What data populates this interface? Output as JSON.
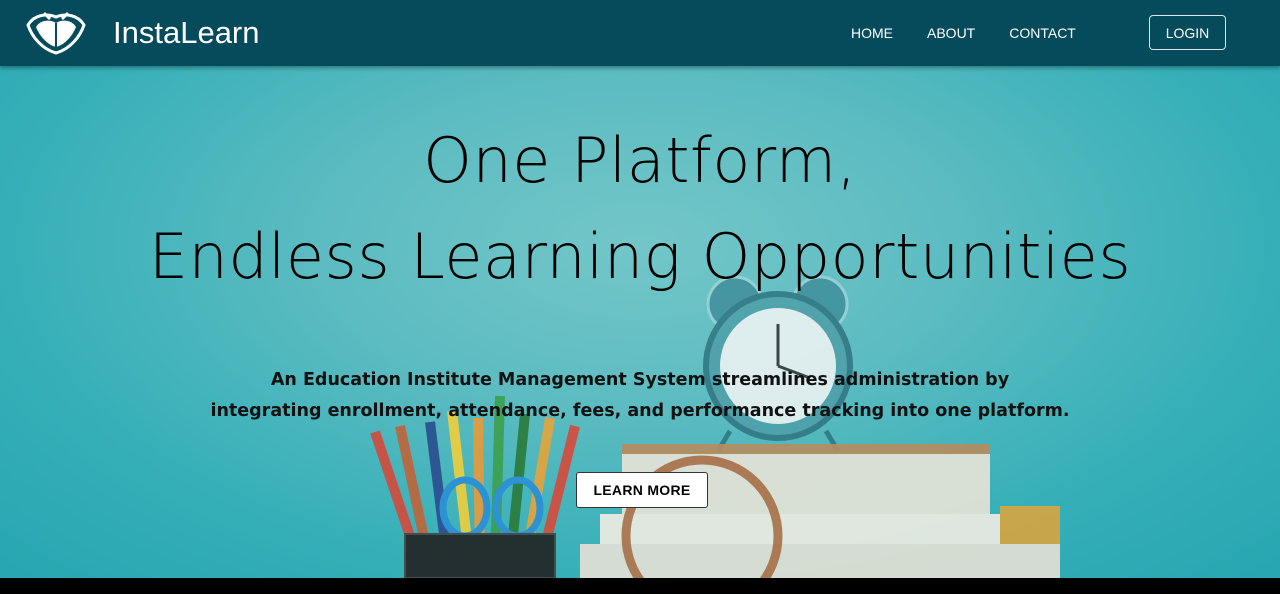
{
  "brand": {
    "name": "InstaLearn",
    "logo_icon": "open-book-shield-icon"
  },
  "nav": {
    "links": [
      "HOME",
      "ABOUT",
      "CONTACT"
    ],
    "login_label": "LOGIN"
  },
  "hero": {
    "headline_line1": "One Platform,",
    "headline_line2": "Endless Learning Opportunities",
    "subtext_line1": "An Education Institute Management System streamlines administration by",
    "subtext_line2": "integrating enrollment, attendance, fees, and performance tracking into one platform.",
    "cta_label": "LEARN MORE",
    "background_image": "alarm-clock-books-pencils-photo"
  },
  "colors": {
    "navbar_bg": "#054b5c",
    "hero_bg": "#3fb3bb",
    "text": "#000000",
    "button_bg": "#ffffff"
  }
}
